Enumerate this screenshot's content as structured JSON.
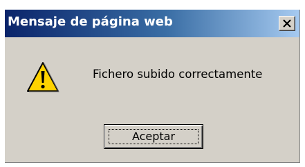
{
  "dialog": {
    "title": "Mensaje de página web",
    "icon": "warning-icon",
    "message": "Fichero subido correctamente",
    "ok_label": "Aceptar",
    "close_icon": "close-icon"
  },
  "colors": {
    "titlebar_start": "#0a246a",
    "titlebar_end": "#a6caf0",
    "dialog_background": "#d4d0c8",
    "warning_yellow": "#ffd200"
  }
}
